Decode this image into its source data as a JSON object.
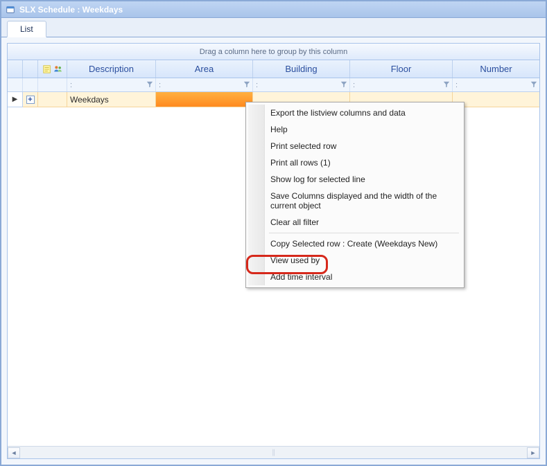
{
  "window": {
    "title": "SLX Schedule : Weekdays"
  },
  "tabs": {
    "list": "List"
  },
  "grid": {
    "group_prompt": "Drag a column here to group by this column",
    "columns": {
      "description": "Description",
      "area": "Area",
      "building": "Building",
      "floor": "Floor",
      "number": "Number"
    },
    "filter_placeholder": ":",
    "row": {
      "description": "Weekdays"
    }
  },
  "ctx": {
    "items": [
      "Export the listview columns and data",
      "Help",
      "Print selected row",
      "Print all rows (1)",
      "Show log for selected line",
      "Save Columns displayed and the width of the current object",
      "Clear all filter"
    ],
    "items2": [
      "Copy Selected row : Create (Weekdays New)",
      "View used by",
      "Add time interval"
    ]
  }
}
